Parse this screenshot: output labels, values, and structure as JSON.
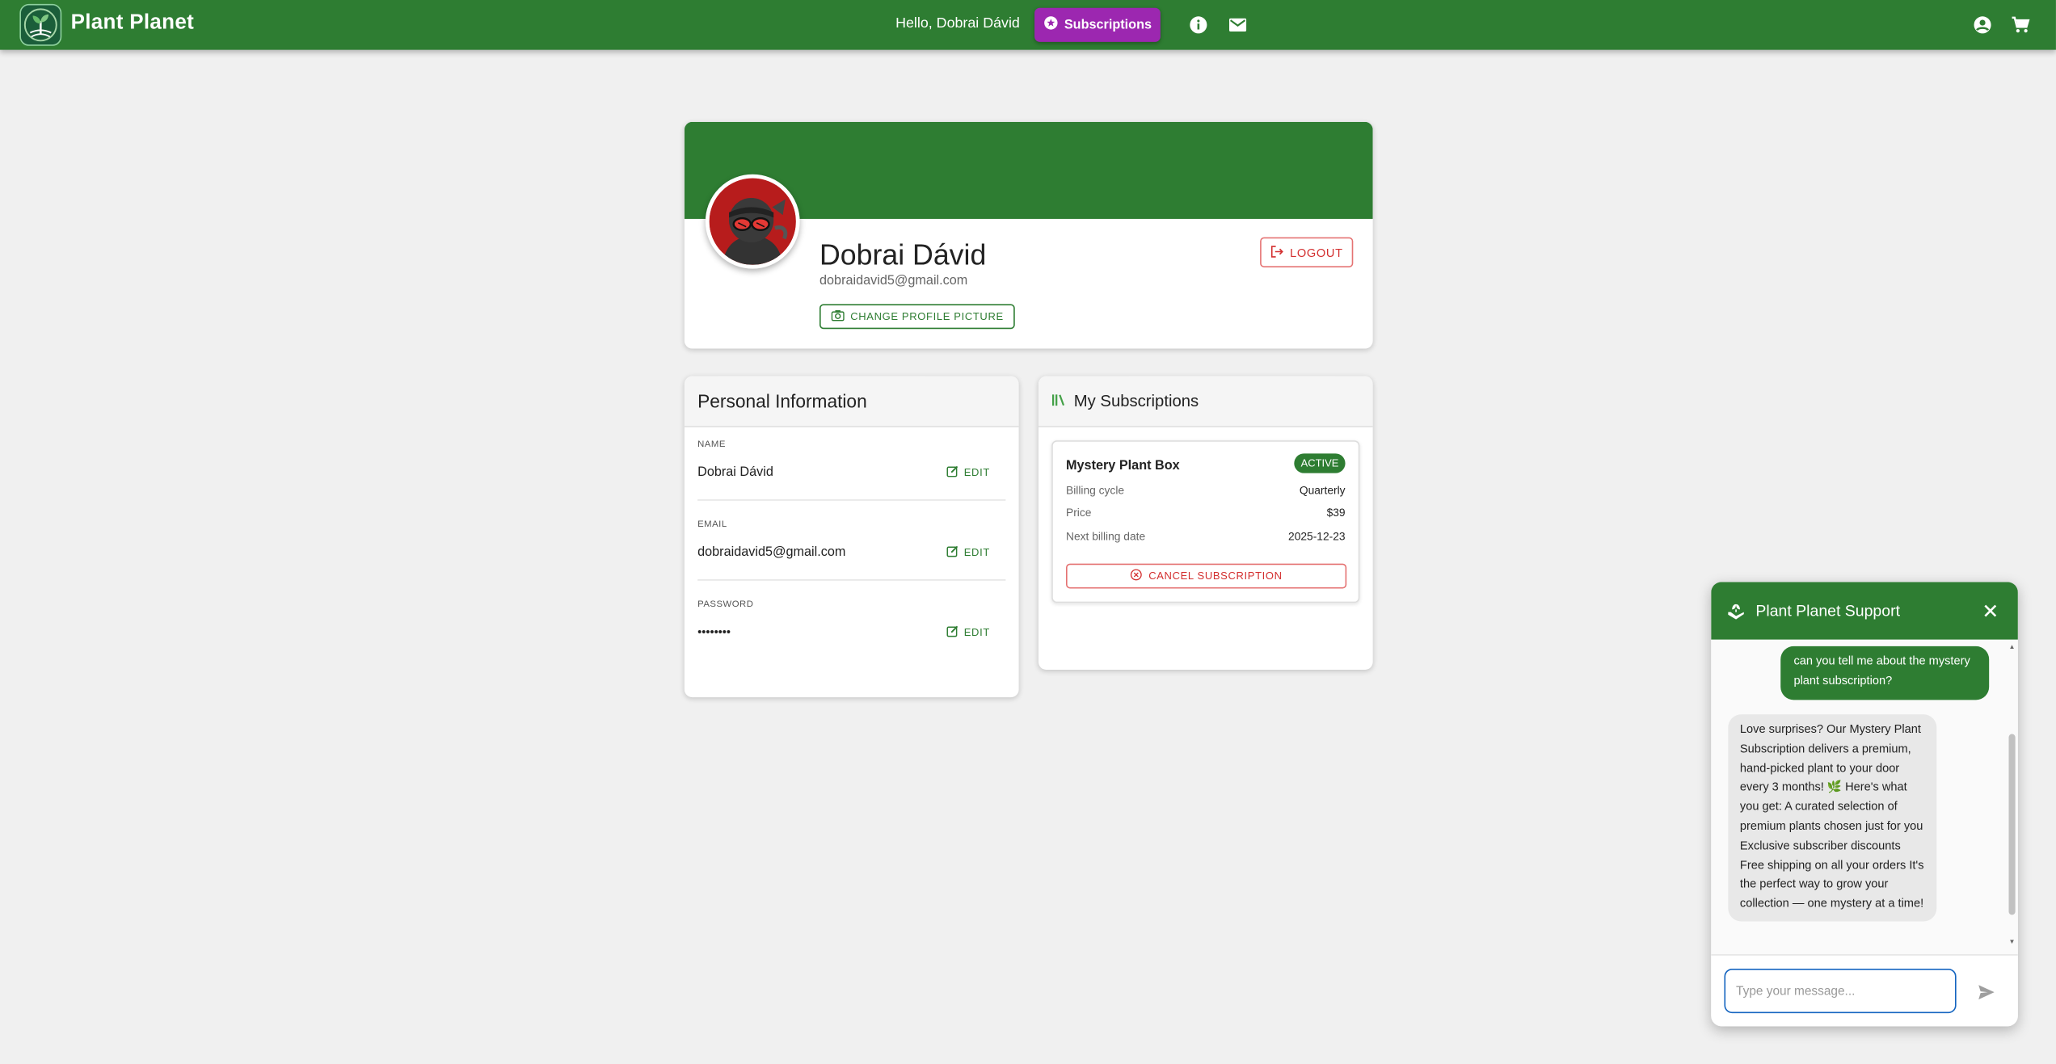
{
  "app": {
    "brand": "Plant Planet",
    "greeting": "Hello, Dobrai Dávid",
    "subscriptions_label": "Subscriptions",
    "icons": [
      "info-icon",
      "mail-icon",
      "account-icon",
      "cart-icon"
    ]
  },
  "profile": {
    "name": "Dobrai Dávid",
    "email": "dobraidavid5@gmail.com",
    "change_picture_label": "CHANGE PROFILE PICTURE",
    "logout_label": "LOGOUT"
  },
  "personal_info": {
    "title": "Personal Information",
    "fields": [
      {
        "label": "NAME",
        "value": "Dobrai Dávid",
        "edit_label": "EDIT"
      },
      {
        "label": "EMAIL",
        "value": "dobraidavid5@gmail.com",
        "edit_label": "EDIT"
      },
      {
        "label": "PASSWORD",
        "value": "••••••••",
        "edit_label": "EDIT"
      }
    ]
  },
  "subscriptions": {
    "title": "My Subscriptions",
    "items": [
      {
        "name": "Mystery Plant Box",
        "status": "ACTIVE",
        "rows": [
          {
            "label": "Billing cycle",
            "value": "Quarterly"
          },
          {
            "label": "Price",
            "value": "$39"
          },
          {
            "label": "Next billing date",
            "value": "2025-12-23"
          }
        ],
        "cancel_label": "CANCEL SUBSCRIPTION"
      }
    ]
  },
  "chat": {
    "title": "Plant Planet Support",
    "messages": [
      {
        "from": "user",
        "text": "can you tell me about the mystery plant subscription?"
      },
      {
        "from": "bot",
        "text": "Love surprises? Our Mystery Plant Subscription delivers a premium, hand-picked plant to your door every 3 months! 🌿 Here's what you get: A curated selection of premium plants chosen just for you Exclusive subscriber discounts Free shipping on all your orders It's the perfect way to grow your collection — one mystery at a time!"
      }
    ],
    "input_value": "",
    "input_placeholder": "Type your message..."
  },
  "colors": {
    "primary": "#2e7d32",
    "accent": "#9c27b0",
    "danger": "#d32f2f",
    "background": "#f0f0f0"
  }
}
